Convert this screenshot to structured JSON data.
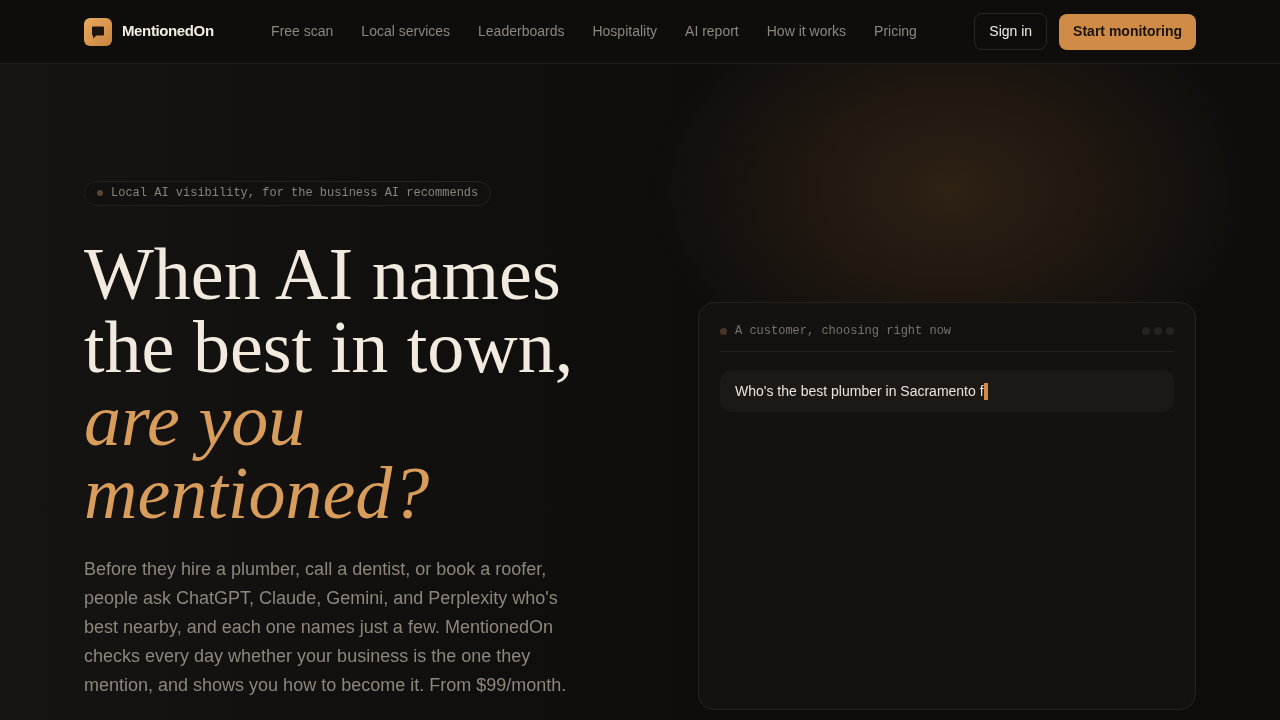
{
  "header": {
    "brand": "MentionedOn",
    "nav": [
      "Free scan",
      "Local services",
      "Leaderboards",
      "Hospitality",
      "AI report",
      "How it works",
      "Pricing"
    ],
    "sign_in": "Sign in",
    "cta": "Start monitoring"
  },
  "hero": {
    "eyebrow": "Local AI visibility, for the business AI recommends",
    "headline": "When AI names the best in town,",
    "headline_accent": "are you mentioned?",
    "body": "Before they hire a plumber, call a dentist, or book a roofer, people ask ChatGPT, Claude, Gemini, and Perplexity who's best nearby, and each one names just a few. MentionedOn checks every day whether your business is the one they mention, and shows you how to become it. From $99/month."
  },
  "demo_card": {
    "caption": "A customer, choosing right now",
    "query": "Who's the best plumber in Sacramento f"
  }
}
